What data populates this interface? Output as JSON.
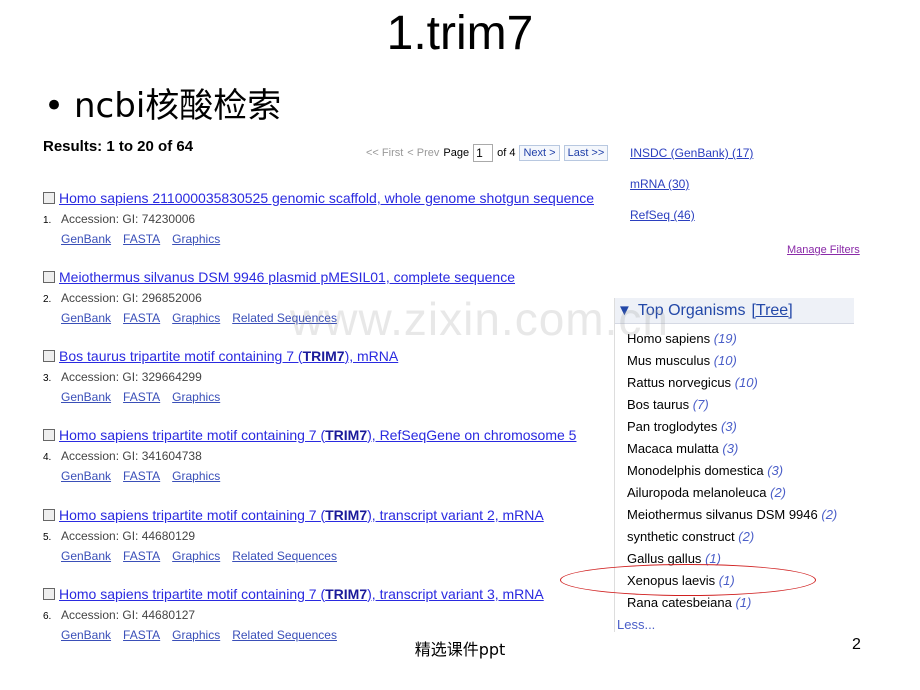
{
  "slide": {
    "title": "1.trim7",
    "bullet": "ncbi核酸检索",
    "footer": "精选课件ppt",
    "page_number": "2",
    "watermark": "www.zixin.com.cn"
  },
  "results_header": {
    "count_text": "Results: 1 to 20 of 64"
  },
  "pager": {
    "first": "<< First",
    "prev": "< Prev",
    "page_label": "Page",
    "page_value": "1",
    "of_label": "of 4",
    "next": "Next >",
    "last": "Last >>"
  },
  "results": [
    {
      "num": "1.",
      "title": "Homo sapiens 211000035830525 genomic scaffold, whole genome shotgun sequence",
      "accession": "Accession:  GI: 74230006",
      "links": [
        "GenBank",
        "FASTA",
        "Graphics"
      ]
    },
    {
      "num": "2.",
      "title": "Meiothermus silvanus DSM 9946 plasmid pMESIL01, complete sequence",
      "accession": "Accession:  GI: 296852006",
      "links": [
        "GenBank",
        "FASTA",
        "Graphics",
        "Related Sequences"
      ]
    },
    {
      "num": "3.",
      "title_pre": "Bos taurus tripartite motif containing 7 (",
      "title_bold": "TRIM7",
      "title_post": "), mRNA",
      "accession": "Accession:  GI: 329664299",
      "links": [
        "GenBank",
        "FASTA",
        "Graphics"
      ]
    },
    {
      "num": "4.",
      "title_pre": "Homo sapiens tripartite motif containing 7 (",
      "title_bold": "TRIM7",
      "title_post": "), RefSeqGene on chromosome 5",
      "accession": "Accession:  GI: 341604738",
      "links": [
        "GenBank",
        "FASTA",
        "Graphics"
      ]
    },
    {
      "num": "5.",
      "title_pre": "Homo sapiens tripartite motif containing 7 (",
      "title_bold": "TRIM7",
      "title_post": "), transcript variant 2, mRNA",
      "accession": "Accession:  GI: 44680129",
      "links": [
        "GenBank",
        "FASTA",
        "Graphics",
        "Related Sequences"
      ]
    },
    {
      "num": "6.",
      "title_pre": "Homo sapiens tripartite motif containing 7 (",
      "title_bold": "TRIM7",
      "title_post": "), transcript variant 3, mRNA",
      "accession": "Accession:  GI: 44680127",
      "links": [
        "GenBank",
        "FASTA",
        "Graphics",
        "Related Sequences"
      ]
    }
  ],
  "filters": {
    "items": [
      "INSDC (GenBank) (17)",
      "mRNA (30)",
      "RefSeq (46)"
    ],
    "manage": "Manage Filters"
  },
  "top_organisms": {
    "header": "Top Organisms",
    "tree": "[Tree]",
    "items": [
      {
        "name": "Homo sapiens",
        "count": "(19)"
      },
      {
        "name": "Mus musculus",
        "count": "(10)"
      },
      {
        "name": "Rattus norvegicus",
        "count": "(10)"
      },
      {
        "name": "Bos taurus",
        "count": "(7)"
      },
      {
        "name": "Pan troglodytes",
        "count": "(3)"
      },
      {
        "name": "Macaca mulatta",
        "count": "(3)"
      },
      {
        "name": "Monodelphis domestica",
        "count": "(3)"
      },
      {
        "name": "Ailuropoda melanoleuca",
        "count": "(2)"
      },
      {
        "name": "Meiothermus silvanus DSM 9946",
        "count": "(2)"
      },
      {
        "name": "synthetic construct",
        "count": "(2)"
      },
      {
        "name": "Gallus gallus",
        "count": "(1)"
      },
      {
        "name": "Xenopus laevis",
        "count": "(1)"
      },
      {
        "name": "Rana catesbeiana",
        "count": "(1)"
      }
    ],
    "less": "Less..."
  },
  "colors": {
    "link": "#2a2ae0",
    "highlight_ellipse": "#d02020",
    "visited": "#8a2aa8"
  }
}
